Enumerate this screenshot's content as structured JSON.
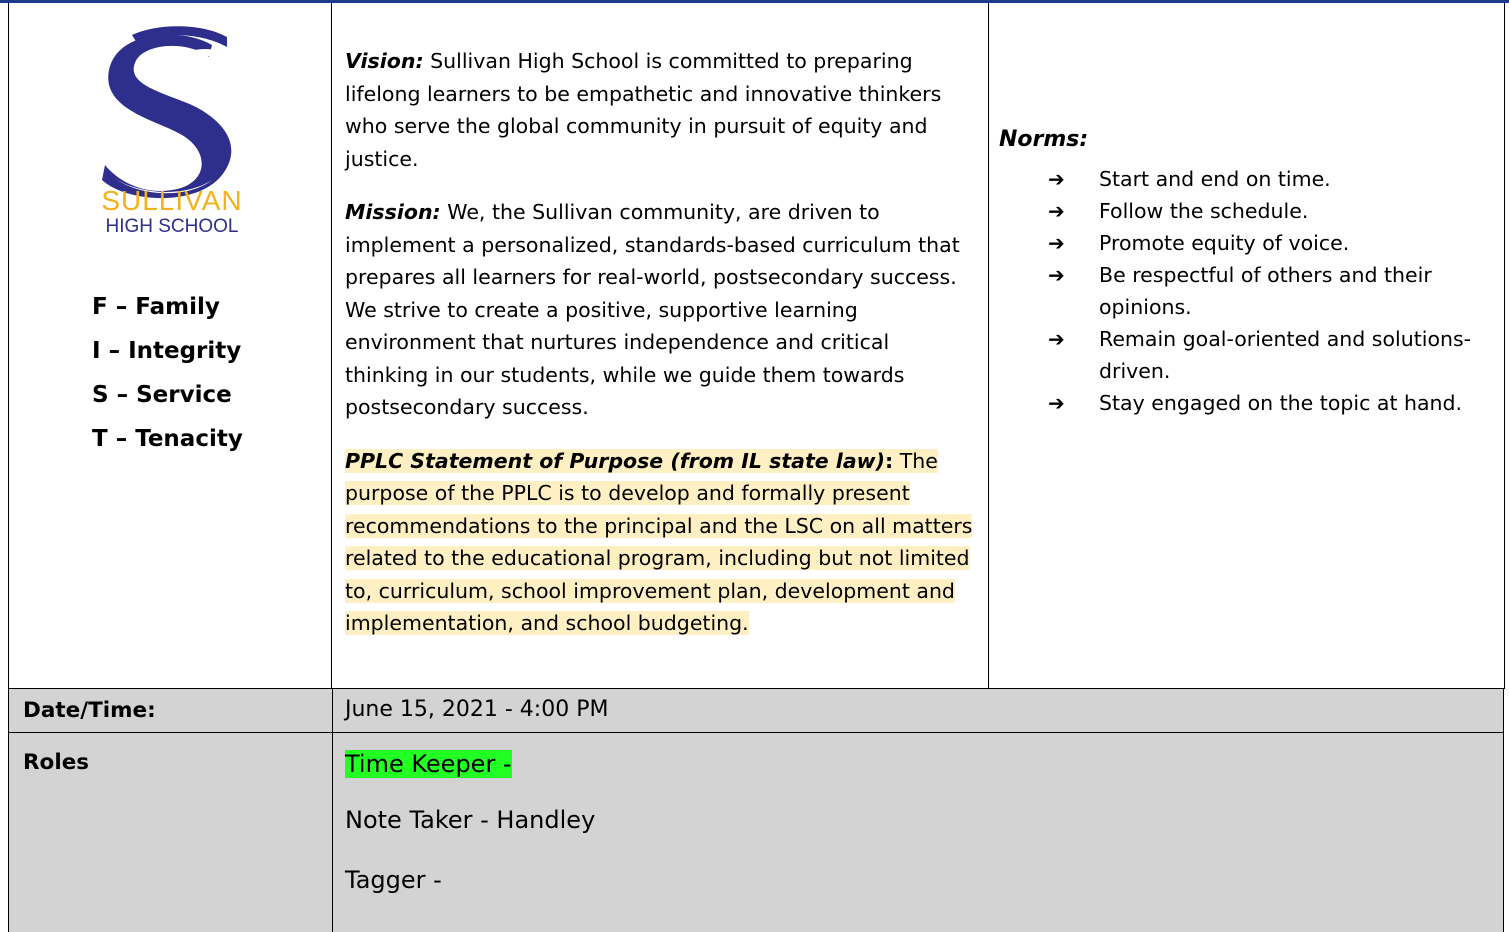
{
  "logo": {
    "line1": "SULLIVAN",
    "line2": "HIGH SCHOOL",
    "brand_color": "#2e2e8c",
    "accent_color": "#f2b21e"
  },
  "values": [
    "F – Family",
    "I – Integrity",
    "S – Service",
    "T – Tenacity"
  ],
  "vision": {
    "label": "Vision:",
    "text": " Sullivan High School is committed to preparing lifelong learners to be empathetic and innovative thinkers who serve the global community in pursuit of equity and justice."
  },
  "mission": {
    "label": "Mission:",
    "text": " We, the Sullivan community, are driven to implement a personalized, standards-based curriculum that prepares all learners for real-world, postsecondary success. We strive to create a positive, supportive learning environment that nurtures independence and critical thinking in our students, while we guide them towards postsecondary success."
  },
  "pplc": {
    "label": "PPLC Statement of Purpose (from IL state law)",
    "colon": ":",
    "text": " The purpose of the PPLC is to develop and formally present recommendations to the principal and the LSC on all matters related to the educational program, including but not limited to, curriculum, school improvement plan, development and implementation, and school budgeting.",
    "highlight_color": "#fff0c4"
  },
  "norms": {
    "title": "Norms:",
    "items": [
      "Start and end on time.",
      "Follow the schedule.",
      "Promote equity of voice.",
      "Be respectful of others and their opinions.",
      "Remain goal-oriented and solutions-driven.",
      "Stay engaged on the topic at hand."
    ],
    "arrow": "➔"
  },
  "meeting": {
    "date_label": "Date/Time:",
    "date_value": "June 15, 2021 - 4:00 PM",
    "roles_label": "Roles",
    "roles": [
      "Time Keeper -",
      "Note Taker - Handley",
      "Tagger -"
    ],
    "row_background": "#d3d3d3",
    "time_keeper_highlight": "#22ff22"
  }
}
